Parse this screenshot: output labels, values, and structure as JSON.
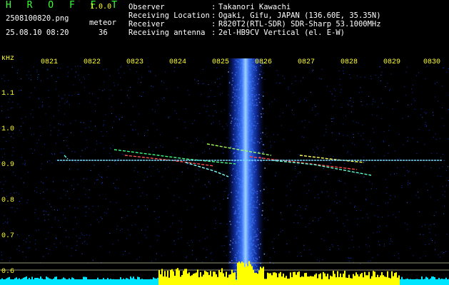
{
  "app": {
    "title": "H R O F F T",
    "version": "1.0.0"
  },
  "file": {
    "name": "2508100820.png",
    "datetime": "25.08.10 08:20"
  },
  "meteor": {
    "label": "meteor",
    "count": "36"
  },
  "info": [
    {
      "label": "Observer",
      "value": "Takanori Kawachi"
    },
    {
      "label": "Receiving Location",
      "value": "Ogaki, Gifu, JAPAN (136.60E, 35.35N)"
    },
    {
      "label": "Receiver",
      "value": "R820T2(RTL-SDR) SDR-Sharp 53.1000MHz"
    },
    {
      "label": "Receiving antenna",
      "value": "2el-HB9CV Vertical (el. E-W)"
    }
  ],
  "info_separator": ":",
  "axis": {
    "unit": "kHz",
    "y_ticks": [
      "1.1",
      "1.0",
      "0.9",
      "0.8",
      "0.7",
      "0.6"
    ],
    "x_ticks": [
      "0821",
      "0822",
      "0823",
      "0824",
      "0825",
      "0826",
      "0827",
      "0828",
      "0829",
      "0830"
    ]
  },
  "colors": {
    "background": "#000000",
    "header_text": "#ffffff",
    "accent": "#39ff39",
    "axis_text": "#ffff33",
    "noise": "#1030c0",
    "spectrum": "#ffff00",
    "spectrum_base": "#00e5ff"
  }
}
